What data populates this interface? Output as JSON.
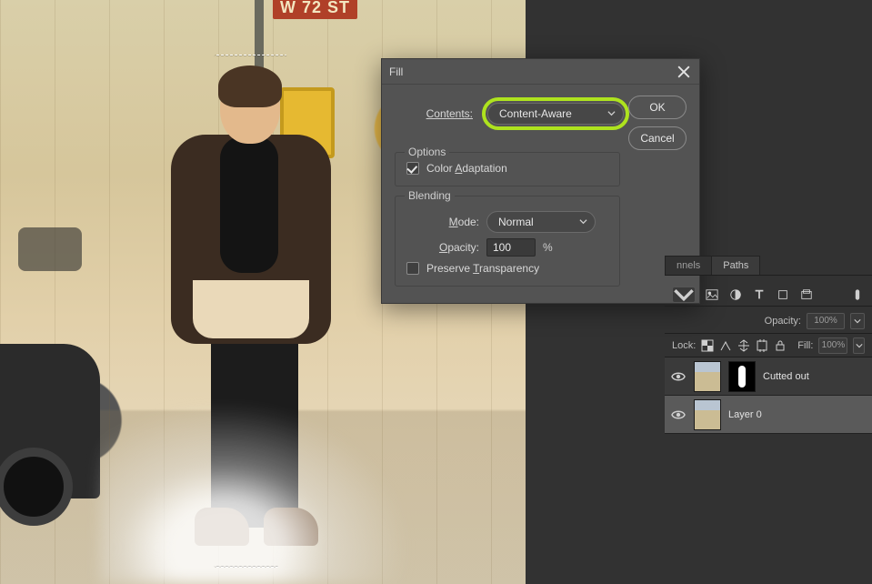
{
  "canvas": {
    "street_sign": "W 72 ST"
  },
  "dialog": {
    "title": "Fill",
    "contents_label": "Contents:",
    "contents_value": "Content-Aware",
    "ok": "OK",
    "cancel": "Cancel",
    "options_legend": "Options",
    "color_adaptation": "Color Adaptation",
    "blending_legend": "Blending",
    "mode_label": "Mode:",
    "mode_value": "Normal",
    "opacity_label": "Opacity:",
    "opacity_value": "100",
    "opacity_unit": "%",
    "preserve_transparency": "Preserve Transparency"
  },
  "panel": {
    "tabs": {
      "channels": "nnels",
      "paths": "Paths"
    },
    "opacity_label": "Opacity:",
    "opacity_value": "100%",
    "lock_label": "Lock:",
    "fill_label": "Fill:",
    "fill_value": "100%",
    "layers": [
      {
        "name": "Cutted out",
        "has_mask": true
      },
      {
        "name": "Layer 0",
        "has_mask": false
      }
    ]
  }
}
